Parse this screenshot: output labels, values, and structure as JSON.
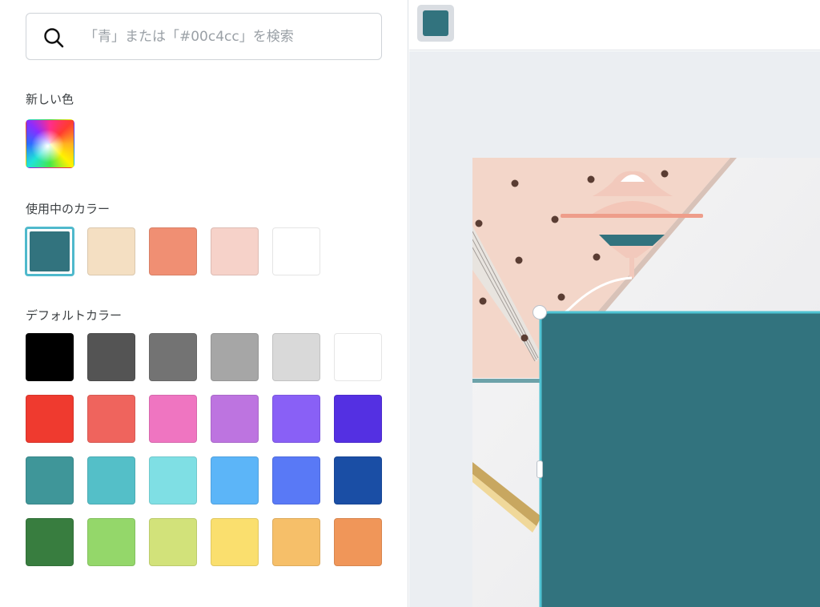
{
  "search": {
    "placeholder": "「青」または「#00c4cc」を検索",
    "icon": "search-icon"
  },
  "sections": {
    "new_color": "新しい色",
    "document_colors": "使用中のカラー",
    "default_colors": "デフォルトカラー"
  },
  "selected_color": "#32737e",
  "document_colors": [
    "#32737e",
    "#f4dfc2",
    "#f08f73",
    "#f6d2c9",
    "#ffffff"
  ],
  "default_colors": [
    [
      "#000000",
      "#545454",
      "#737373",
      "#a6a6a6",
      "#d9d9d9",
      "#ffffff"
    ],
    [
      "#ef3a2f",
      "#ef645d",
      "#ef75c1",
      "#bd74e0",
      "#8960f6",
      "#5430e2"
    ],
    [
      "#3f9699",
      "#54bfc8",
      "#7fdfe4",
      "#5cb5f8",
      "#5979f6",
      "#1a4ea5"
    ],
    [
      "#387d3f",
      "#94d76a",
      "#d2e27a",
      "#fadf6e",
      "#f6bf69",
      "#f09659"
    ]
  ],
  "canvas": {
    "background": "#ebeef2",
    "shape_color": "#32737e",
    "selection_color": "#4fc3d3"
  }
}
